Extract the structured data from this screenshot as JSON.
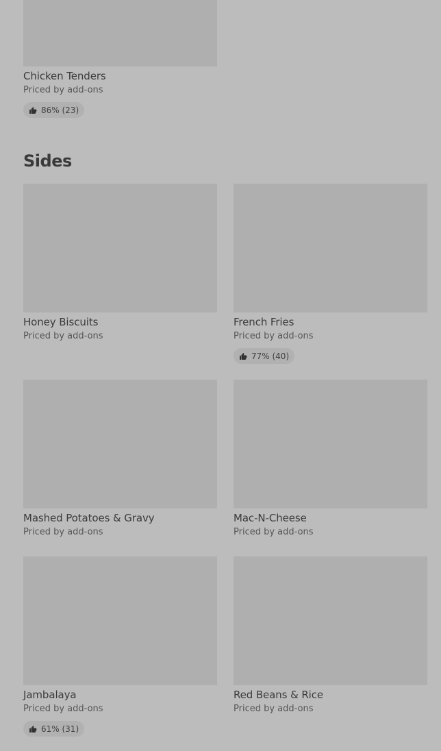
{
  "top_item": {
    "name": "Chicken Tenders",
    "price": "Priced by add-ons",
    "rating": "86% (23)"
  },
  "sides": {
    "heading": "Sides",
    "items": [
      {
        "name": "Honey Biscuits",
        "price": "Priced by add-ons"
      },
      {
        "name": "French Fries",
        "price": "Priced by add-ons",
        "rating": "77% (40)"
      },
      {
        "name": "Mashed Potatoes & Gravy",
        "price": "Priced by add-ons"
      },
      {
        "name": "Mac-N-Cheese",
        "price": "Priced by add-ons"
      },
      {
        "name": "Jambalaya",
        "price": "Priced by add-ons",
        "rating": "61% (31)"
      },
      {
        "name": "Red Beans & Rice",
        "price": "Priced by add-ons"
      }
    ]
  },
  "icons": {
    "rating": "thumbs-up-icon"
  }
}
